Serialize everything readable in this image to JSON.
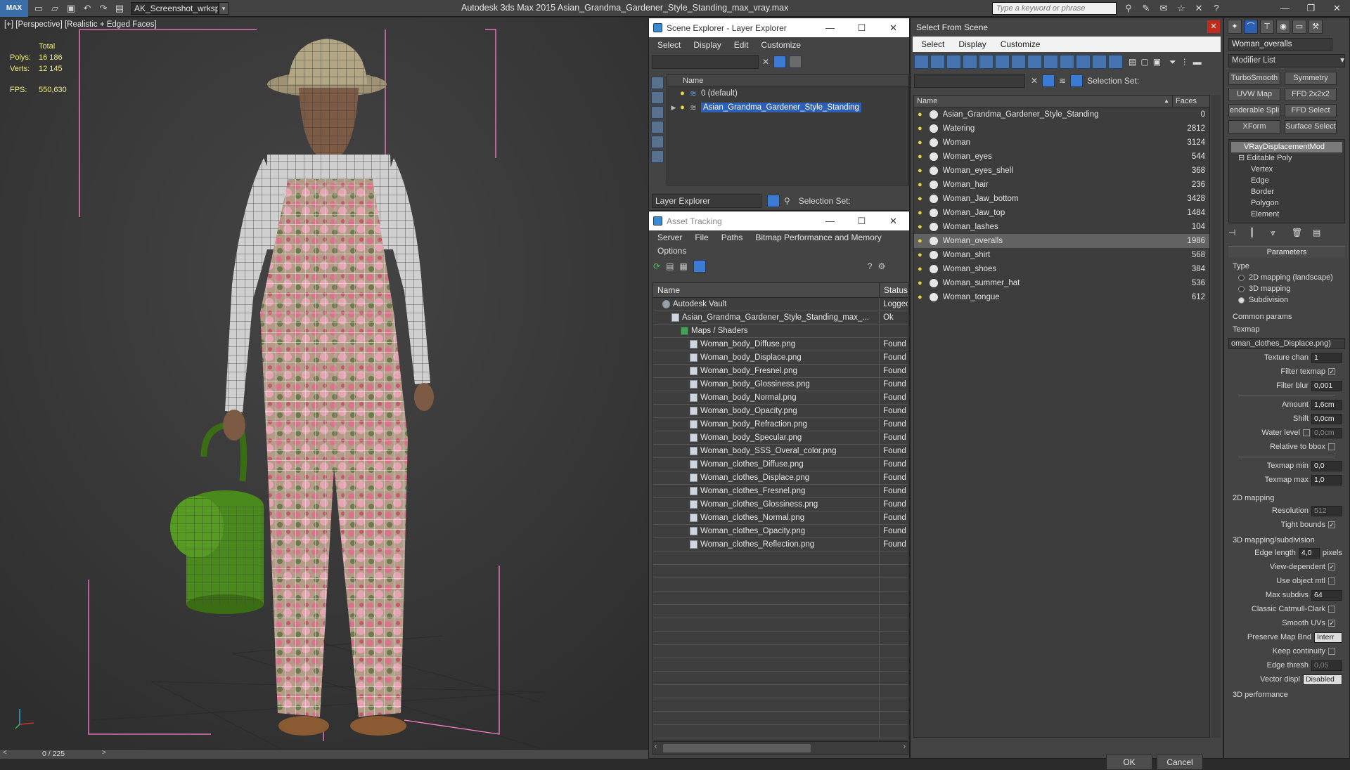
{
  "app": {
    "logo": "MAX",
    "workspace": "AK_Screenshot_wrksp",
    "title": "Autodesk 3ds Max  2015     Asian_Grandma_Gardener_Style_Standing_max_vray.max",
    "search_placeholder": "Type a keyword or phrase"
  },
  "viewport": {
    "label": "[+] [Perspective] [Realistic + Edged Faces]",
    "stats": {
      "total_label": "Total",
      "polys_label": "Polys:",
      "polys": "16 186",
      "verts_label": "Verts:",
      "verts": "12 145",
      "fps_label": "FPS:",
      "fps": "550,630"
    },
    "frame_counter": "0 / 225",
    "prev": "<",
    "next": ">"
  },
  "scene_explorer": {
    "title": "Scene Explorer - Layer Explorer",
    "menu": [
      "Select",
      "Display",
      "Edit",
      "Customize"
    ],
    "tree_header": "Name",
    "rows": [
      {
        "label": "0 (default)",
        "selected": false
      },
      {
        "label": "Asian_Grandma_Gardener_Style_Standing",
        "selected": true
      }
    ],
    "layer_dropdown": "Layer Explorer",
    "selection_set_label": "Selection Set:"
  },
  "asset_tracking": {
    "title": "Asset Tracking",
    "menu": [
      "Server",
      "File",
      "Paths",
      "Bitmap Performance and Memory",
      "Options"
    ],
    "columns": [
      "Name",
      "Status"
    ],
    "rows": [
      {
        "name": "Autodesk Vault",
        "status": "Logged",
        "indent": 1,
        "icon": "vault"
      },
      {
        "name": "Asian_Grandma_Gardener_Style_Standing_max_...",
        "status": "Ok",
        "indent": 2,
        "icon": "file"
      },
      {
        "name": "Maps / Shaders",
        "status": "",
        "indent": 3,
        "icon": "folder"
      },
      {
        "name": "Woman_body_Diffuse.png",
        "status": "Found",
        "indent": 4,
        "icon": "file"
      },
      {
        "name": "Woman_body_Displace.png",
        "status": "Found",
        "indent": 4,
        "icon": "file"
      },
      {
        "name": "Woman_body_Fresnel.png",
        "status": "Found",
        "indent": 4,
        "icon": "file"
      },
      {
        "name": "Woman_body_Glossiness.png",
        "status": "Found",
        "indent": 4,
        "icon": "file"
      },
      {
        "name": "Woman_body_Normal.png",
        "status": "Found",
        "indent": 4,
        "icon": "file"
      },
      {
        "name": "Woman_body_Opacity.png",
        "status": "Found",
        "indent": 4,
        "icon": "file"
      },
      {
        "name": "Woman_body_Refraction.png",
        "status": "Found",
        "indent": 4,
        "icon": "file"
      },
      {
        "name": "Woman_body_Specular.png",
        "status": "Found",
        "indent": 4,
        "icon": "file"
      },
      {
        "name": "Woman_body_SSS_Overal_color.png",
        "status": "Found",
        "indent": 4,
        "icon": "file"
      },
      {
        "name": "Woman_clothes_Diffuse.png",
        "status": "Found",
        "indent": 4,
        "icon": "file"
      },
      {
        "name": "Woman_clothes_Displace.png",
        "status": "Found",
        "indent": 4,
        "icon": "file"
      },
      {
        "name": "Woman_clothes_Fresnel.png",
        "status": "Found",
        "indent": 4,
        "icon": "file"
      },
      {
        "name": "Woman_clothes_Glossiness.png",
        "status": "Found",
        "indent": 4,
        "icon": "file"
      },
      {
        "name": "Woman_clothes_Normal.png",
        "status": "Found",
        "indent": 4,
        "icon": "file"
      },
      {
        "name": "Woman_clothes_Opacity.png",
        "status": "Found",
        "indent": 4,
        "icon": "file"
      },
      {
        "name": "Woman_clothes_Reflection.png",
        "status": "Found",
        "indent": 4,
        "icon": "file"
      }
    ]
  },
  "select_from_scene": {
    "title": "Select From Scene",
    "menu": [
      "Select",
      "Display",
      "Customize"
    ],
    "selection_set_label": "Selection Set:",
    "columns": [
      "Name",
      "Faces"
    ],
    "rows": [
      {
        "name": "Asian_Grandma_Gardener_Style_Standing",
        "faces": "0",
        "selected": false
      },
      {
        "name": "Watering",
        "faces": "2812",
        "selected": false
      },
      {
        "name": "Woman",
        "faces": "3124",
        "selected": false
      },
      {
        "name": "Woman_eyes",
        "faces": "544",
        "selected": false
      },
      {
        "name": "Woman_eyes_shell",
        "faces": "368",
        "selected": false
      },
      {
        "name": "Woman_hair",
        "faces": "236",
        "selected": false
      },
      {
        "name": "Woman_Jaw_bottom",
        "faces": "3428",
        "selected": false
      },
      {
        "name": "Woman_Jaw_top",
        "faces": "1484",
        "selected": false
      },
      {
        "name": "Woman_lashes",
        "faces": "104",
        "selected": false
      },
      {
        "name": "Woman_overalls",
        "faces": "1986",
        "selected": true
      },
      {
        "name": "Woman_shirt",
        "faces": "568",
        "selected": false
      },
      {
        "name": "Woman_shoes",
        "faces": "384",
        "selected": false
      },
      {
        "name": "Woman_summer_hat",
        "faces": "536",
        "selected": false
      },
      {
        "name": "Woman_tongue",
        "faces": "612",
        "selected": false
      }
    ],
    "ok": "OK",
    "cancel": "Cancel"
  },
  "command_panel": {
    "object_name": "Woman_overalls",
    "modifier_list": "Modifier List",
    "buttons": [
      "TurboSmooth",
      "Symmetry",
      "UVW Map",
      "FFD 2x2x2",
      "enderable Spli",
      "FFD Select",
      "XForm",
      "Surface Select"
    ],
    "stack": {
      "top": "VRayDisplacementMod",
      "base": "Editable Poly",
      "subs": [
        "Vertex",
        "Edge",
        "Border",
        "Polygon",
        "Element"
      ]
    },
    "parameters": {
      "header": "Parameters",
      "type_label": "Type",
      "types": [
        {
          "label": "2D mapping (landscape)",
          "on": false
        },
        {
          "label": "3D mapping",
          "on": false
        },
        {
          "label": "Subdivision",
          "on": true
        }
      ],
      "common_label": "Common params",
      "texmap_label": "Texmap",
      "texmap_value": "oman_clothes_Displace.png)",
      "texture_chan_label": "Texture chan",
      "texture_chan": "1",
      "filter_texmap_label": "Filter texmap",
      "filter_blur_label": "Filter blur",
      "filter_blur": "0,001",
      "amount_label": "Amount",
      "amount": "1,6cm",
      "shift_label": "Shift",
      "shift": "0,0cm",
      "water_level_label": "Water level",
      "water_level": "0,0cm",
      "relative_label": "Relative to bbox",
      "texmap_min_label": "Texmap min",
      "texmap_min": "0,0",
      "texmap_max_label": "Texmap max",
      "texmap_max": "1,0",
      "map2d_label": "2D mapping",
      "resolution_label": "Resolution",
      "resolution": "512",
      "tight_label": "Tight bounds",
      "map3d_label": "3D mapping/subdivision",
      "edge_length_label": "Edge length",
      "edge_length": "4,0",
      "pixels": "pixels",
      "view_dep_label": "View-dependent",
      "use_obj_label": "Use object mtl",
      "max_subdivs_label": "Max subdivs",
      "max_subdivs": "64",
      "catmull_label": "Classic Catmull-Clark",
      "smooth_uvs_label": "Smooth UVs",
      "preserve_label": "Preserve Map Bnd",
      "preserve": "Interr",
      "keep_cont_label": "Keep continuity",
      "edge_thresh_label": "Edge thresh",
      "edge_thresh": "0,05",
      "vector_label": "Vector displ",
      "vector": "Disabled",
      "perf_label": "3D performance"
    }
  },
  "colors": {
    "selection_blue": "#2d5fb4",
    "stats_yellow": "#f0ef7a",
    "bbox_pink": "#ff7fd0",
    "can_green": "#4a8a1c"
  }
}
